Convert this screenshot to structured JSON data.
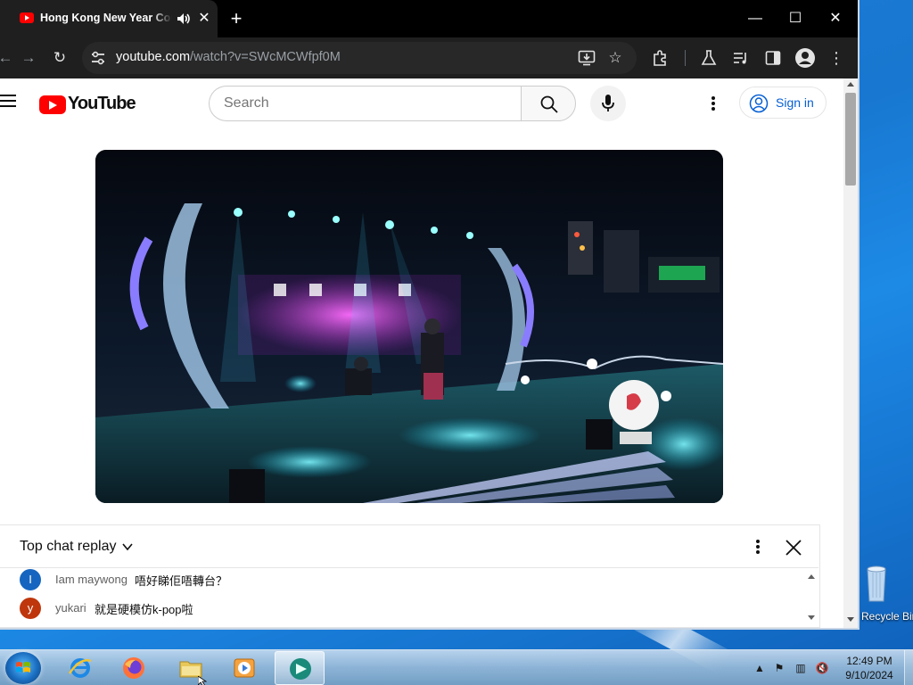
{
  "browser": {
    "tab_title": "Hong Kong New Year Countdown",
    "url_host": "youtube.com",
    "url_path": "/watch?v=SWcMCWfpf0M"
  },
  "youtube": {
    "logo_text": "YouTube",
    "search_placeholder": "Search",
    "signin_label": "Sign in"
  },
  "chat": {
    "title": "Top chat replay",
    "messages": [
      {
        "initial": "I",
        "author": "Iam maywong",
        "text": "唔好睇佢唔轉台？",
        "avatar_color": "#1565c0"
      },
      {
        "initial": "y",
        "author": "yukari",
        "text": "就是硬模仿k-pop啦",
        "avatar_color": "#bf360c"
      }
    ]
  },
  "desktop": {
    "recycle_label": "Recycle Bin"
  },
  "taskbar": {
    "time": "12:49 PM",
    "date": "9/10/2024"
  },
  "icons": {
    "tab_favicon": "youtube-favicon",
    "audio": "speaker-icon",
    "back": "back-arrow-icon",
    "forward": "forward-arrow-icon",
    "reload": "reload-icon",
    "bookmark": "star-icon"
  }
}
